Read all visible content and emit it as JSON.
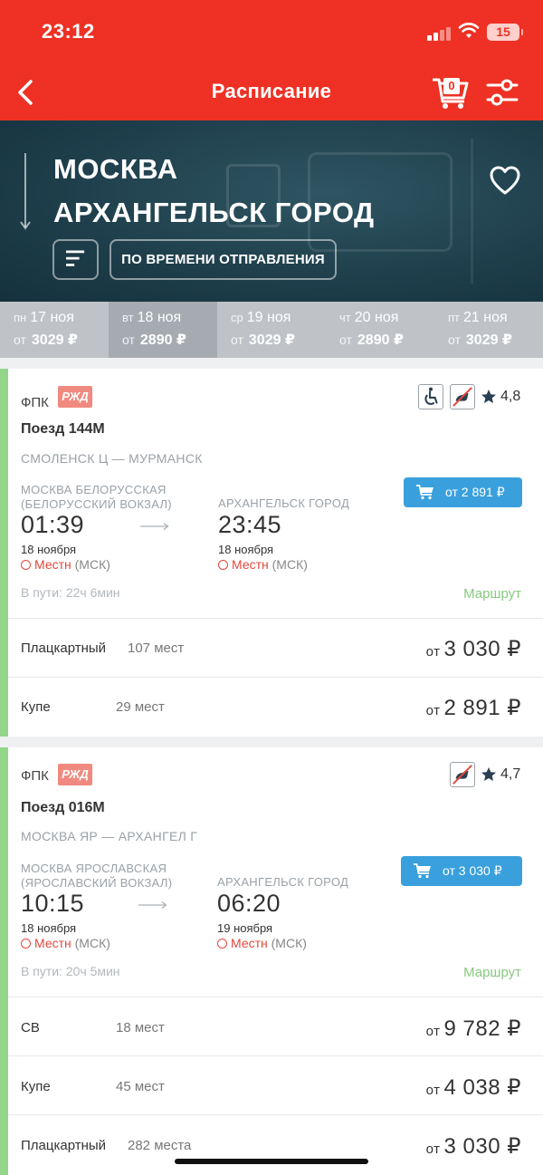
{
  "status": {
    "time": "23:12",
    "battery": "15"
  },
  "header": {
    "title": "Расписание",
    "cart_count": "0"
  },
  "hero": {
    "from": "МОСКВА",
    "to": "АРХАНГЕЛЬСК ГОРОД",
    "sort_label": "ПО ВРЕМЕНИ ОТПРАВЛЕНИЯ"
  },
  "dates": [
    {
      "dow": "пн",
      "date": "17 ноя",
      "ot": "от",
      "price": "3029 ₽"
    },
    {
      "dow": "вт",
      "date": "18 ноя",
      "ot": "от",
      "price": "2890 ₽"
    },
    {
      "dow": "ср",
      "date": "19 ноя",
      "ot": "от",
      "price": "3029 ₽"
    },
    {
      "dow": "чт",
      "date": "20 ноя",
      "ot": "от",
      "price": "2890 ₽"
    },
    {
      "dow": "пт",
      "date": "21 ноя",
      "ot": "от",
      "price": "3029 ₽"
    }
  ],
  "trains": [
    {
      "carrier": "ФПК",
      "logo": "РЖД",
      "rating": "4,8",
      "number": "Поезд 144М",
      "route": "СМОЛЕНСК Ц — МУРМАНСК",
      "dep_station": "МОСКВА БЕЛОРУССКАЯ",
      "dep_station2": "(БЕЛОРУССКИЙ ВОКЗАЛ)",
      "arr_station": "АРХАНГЕЛЬСК ГОРОД",
      "dep_time": "01:39",
      "arr_time": "23:45",
      "dep_date": "18 ноября",
      "arr_date": "18 ноября",
      "tz_local": "Местн",
      "tz_msk": "(МСК)",
      "buy_label": "от 2 891 ₽",
      "duration": "В пути: 22ч 6мин",
      "route_link": "Маршрут",
      "classes": [
        {
          "name": "Плацкартный",
          "seats": "107 мест",
          "ot": "от",
          "price": "3 030 ₽"
        },
        {
          "name": "Купе",
          "seats": "29 мест",
          "ot": "от",
          "price": "2 891 ₽"
        }
      ]
    },
    {
      "carrier": "ФПК",
      "logo": "РЖД",
      "rating": "4,7",
      "number": "Поезд 016М",
      "route": "МОСКВА ЯР — АРХАНГЕЛ Г",
      "dep_station": "МОСКВА ЯРОСЛАВСКАЯ",
      "dep_station2": "(ЯРОСЛАВСКИЙ ВОКЗАЛ)",
      "arr_station": "АРХАНГЕЛЬСК ГОРОД",
      "dep_time": "10:15",
      "arr_time": "06:20",
      "dep_date": "18 ноября",
      "arr_date": "19 ноября",
      "tz_local": "Местн",
      "tz_msk": "(МСК)",
      "buy_label": "от 3 030 ₽",
      "duration": "В пути: 20ч 5мин",
      "route_link": "Маршрут",
      "classes": [
        {
          "name": "СВ",
          "seats": "18 мест",
          "ot": "от",
          "price": "9 782 ₽"
        },
        {
          "name": "Купе",
          "seats": "45 мест",
          "ot": "от",
          "price": "4 038 ₽"
        },
        {
          "name": "Плацкартный",
          "seats": "282 места",
          "ot": "от",
          "price": "3 030 ₽"
        }
      ]
    }
  ],
  "colors": {
    "brand_red": "#ee3124",
    "buy_blue": "#3aa0dd",
    "accent_green": "#93d68a",
    "hero_bg": "#1f3f4c"
  },
  "icons": [
    "back-icon",
    "cart-icon",
    "filter-icon",
    "heart-icon",
    "sort-icon",
    "wheelchair-icon",
    "no-pets-icon",
    "star-icon",
    "clock-icon"
  ]
}
